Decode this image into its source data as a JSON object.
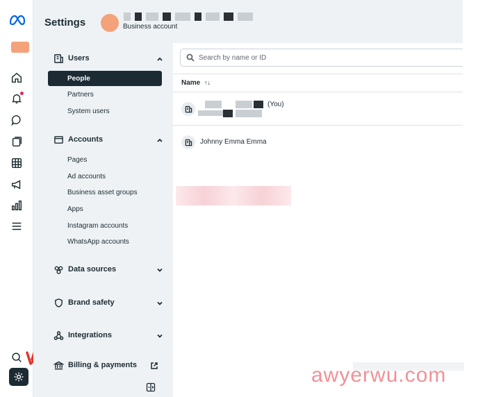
{
  "header": {
    "title": "Settings",
    "account_type": "Business account"
  },
  "sidebar": {
    "sections": [
      {
        "label": "Users",
        "items": [
          "People",
          "Partners",
          "System users"
        ],
        "active": "People"
      },
      {
        "label": "Accounts",
        "items": [
          "Pages",
          "Ad accounts",
          "Business asset groups",
          "Apps",
          "Instagram accounts",
          "WhatsApp accounts"
        ]
      },
      {
        "label": "Data sources"
      },
      {
        "label": "Brand safety"
      },
      {
        "label": "Integrations"
      },
      {
        "label": "Billing & payments"
      }
    ]
  },
  "search": {
    "placeholder": "Search by name or ID"
  },
  "table": {
    "column": "Name",
    "sort_glyph": "↑↓",
    "rows": [
      {
        "suffix": "(You)"
      },
      {
        "name": "Johnny Emma Emma"
      }
    ]
  },
  "watermark": "awyerwu.com",
  "colors": {
    "sidebar_bg": "#eef2f5",
    "active_bg": "#1c2b33",
    "meta_blue": "#0668e1",
    "arrow_red": "#e8332a"
  }
}
